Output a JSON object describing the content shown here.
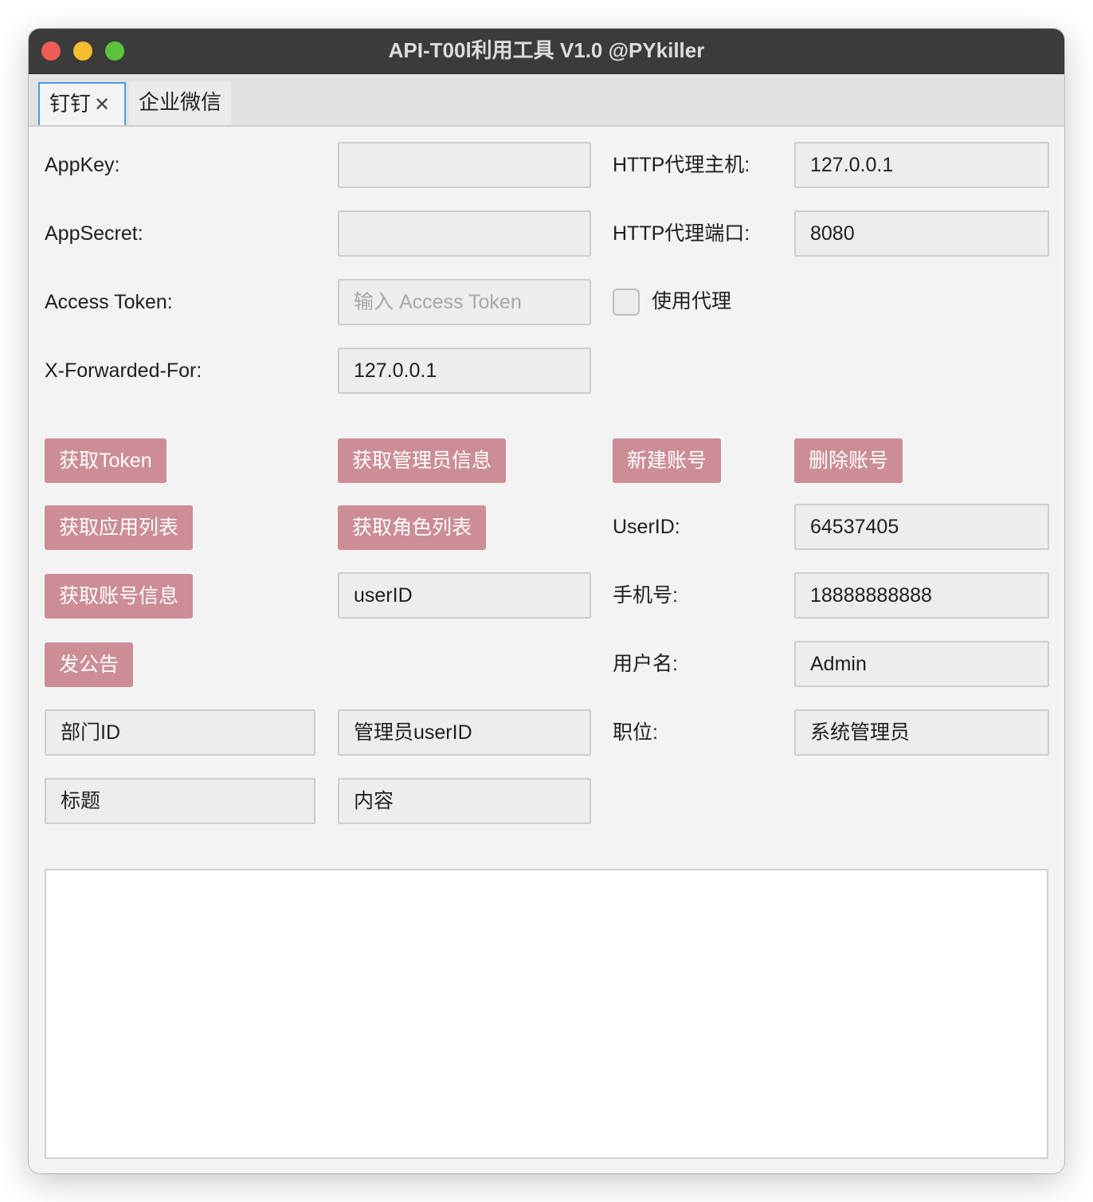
{
  "window": {
    "title": "API-T00l利用工具 V1.0 @PYkiller"
  },
  "tabs": [
    {
      "label": "钉钉",
      "close": "✕"
    },
    {
      "label": "企业微信"
    }
  ],
  "form": {
    "appkey_label": "AppKey:",
    "appkey_value": "",
    "appsecret_label": "AppSecret:",
    "appsecret_value": "",
    "access_token_label": "Access Token:",
    "access_token_placeholder": "输入 Access Token",
    "xff_label": "X-Forwarded-For:",
    "xff_value": "127.0.0.1",
    "proxy_host_label": "HTTP代理主机:",
    "proxy_host_value": "127.0.0.1",
    "proxy_port_label": "HTTP代理端口:",
    "proxy_port_value": "8080",
    "use_proxy_label": "使用代理",
    "use_proxy_checked": false
  },
  "buttons": {
    "get_token": "获取Token",
    "get_admin_info": "获取管理员信息",
    "new_account": "新建账号",
    "delete_account": "删除账号",
    "get_app_list": "获取应用列表",
    "get_role_list": "获取角色列表",
    "get_account_info": "获取账号信息",
    "announce": "发公告"
  },
  "account": {
    "userid_label": "UserID:",
    "userid_value": "64537405",
    "userid_input_value": "userID",
    "phone_label": "手机号:",
    "phone_value": "18888888888",
    "username_label": "用户名:",
    "username_value": "Admin",
    "position_label": "职位:",
    "position_value": "系统管理员"
  },
  "announcement": {
    "dept_id_value": "部门ID",
    "admin_userid_value": "管理员userID",
    "title_value": "标题",
    "content_value": "内容"
  },
  "output": {
    "text": ""
  }
}
